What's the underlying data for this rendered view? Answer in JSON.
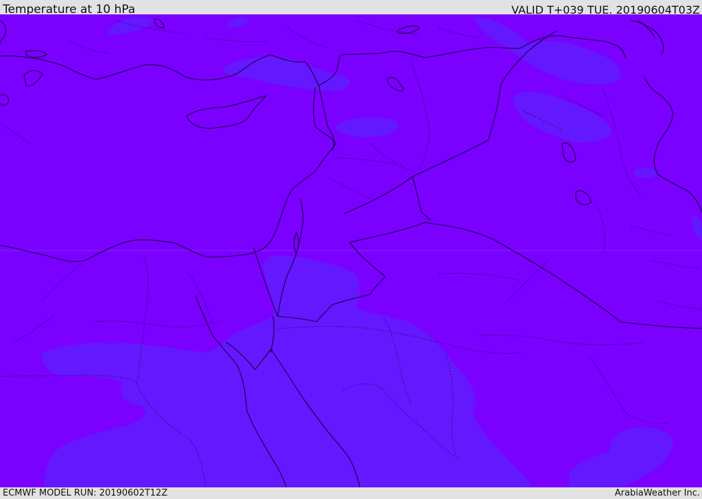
{
  "header": {
    "title": "Temperature at 10 hPa",
    "valid": "VALID T+039 TUE. 20190604T03Z"
  },
  "footer": {
    "model_run": "ECMWF MODEL RUN: 20190602T12Z",
    "brand": "ArabiaWeather Inc."
  },
  "map": {
    "base_fill_color": "#7a00ff",
    "cold_fill_color": "#6418ff",
    "border_color": "#1a0040"
  }
}
